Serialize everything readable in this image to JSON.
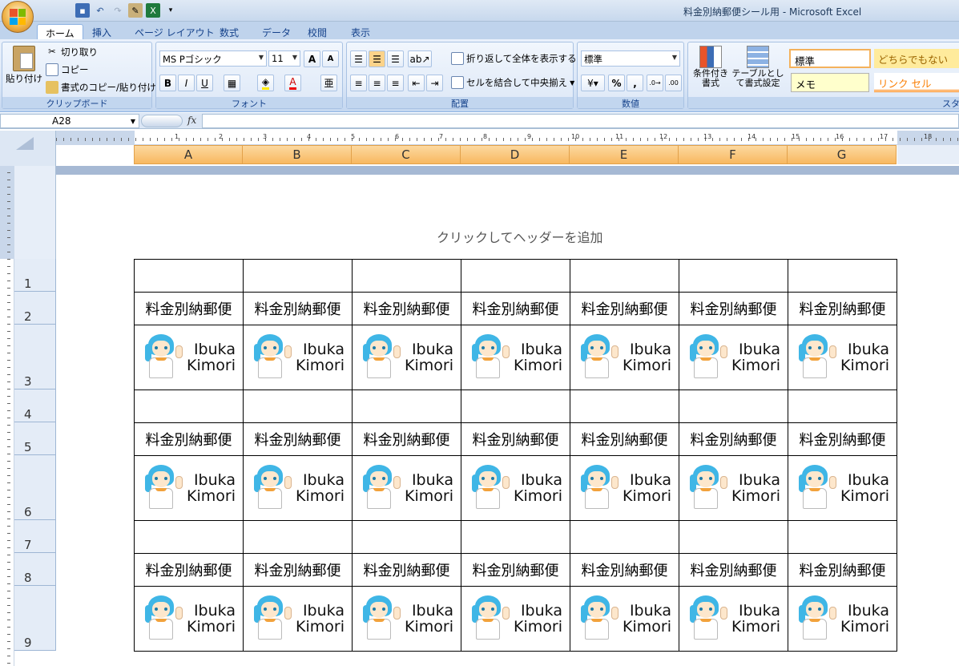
{
  "window": {
    "title": "料金別納郵便シール用 - Microsoft Excel"
  },
  "tabs": [
    "ホーム",
    "挿入",
    "ページ レイアウト",
    "数式",
    "データ",
    "校閲",
    "表示"
  ],
  "ribbon": {
    "clipboard": {
      "label": "クリップボード",
      "paste": "貼り付け",
      "cut": "切り取り",
      "copy": "コピー",
      "format_painter": "書式のコピー/貼り付け"
    },
    "font": {
      "label": "フォント",
      "font_name": "MS Pゴシック",
      "font_size": "11",
      "bold": "B",
      "italic": "I",
      "underline": "U",
      "grow": "A",
      "shrink": "A"
    },
    "alignment": {
      "label": "配置",
      "wrap_text": "折り返して全体を表示する",
      "merge_center": "セルを結合して中央揃え"
    },
    "number": {
      "label": "数値",
      "format": "標準",
      "percent": "%",
      "comma": ","
    },
    "styles": {
      "conditional": "条件付き書式",
      "table": "テーブルとして書式設定",
      "cell_styles": [
        "標準",
        "どちらでもない",
        "メモ",
        "リンク セル"
      ],
      "partial_label": "スタ"
    }
  },
  "formula_bar": {
    "name_box": "A28",
    "fx": "fx",
    "content": ""
  },
  "ruler": {
    "numbers": [
      "1",
      "2",
      "3",
      "4",
      "5",
      "6",
      "7",
      "8",
      "9",
      "10",
      "11",
      "12",
      "13",
      "14",
      "15",
      "16",
      "17",
      "18"
    ]
  },
  "columns": [
    "A",
    "B",
    "C",
    "D",
    "E",
    "F",
    "G"
  ],
  "page": {
    "header_hint": "クリックしてヘッダーを追加"
  },
  "rows": [
    {
      "num": "1",
      "type": "empty"
    },
    {
      "num": "2",
      "type": "label"
    },
    {
      "num": "3",
      "type": "name"
    },
    {
      "num": "4",
      "type": "empty"
    },
    {
      "num": "5",
      "type": "label"
    },
    {
      "num": "6",
      "type": "name"
    },
    {
      "num": "7",
      "type": "empty"
    },
    {
      "num": "8",
      "type": "label"
    },
    {
      "num": "9",
      "type": "name"
    }
  ],
  "cells": {
    "label": "料金別納郵便",
    "name_line1": "Ibuka",
    "name_line2": "Kimori"
  },
  "colors": {
    "hair": "#3fb6e6",
    "column_header": "#f8b860",
    "ribbon": "#dbe7f7"
  }
}
